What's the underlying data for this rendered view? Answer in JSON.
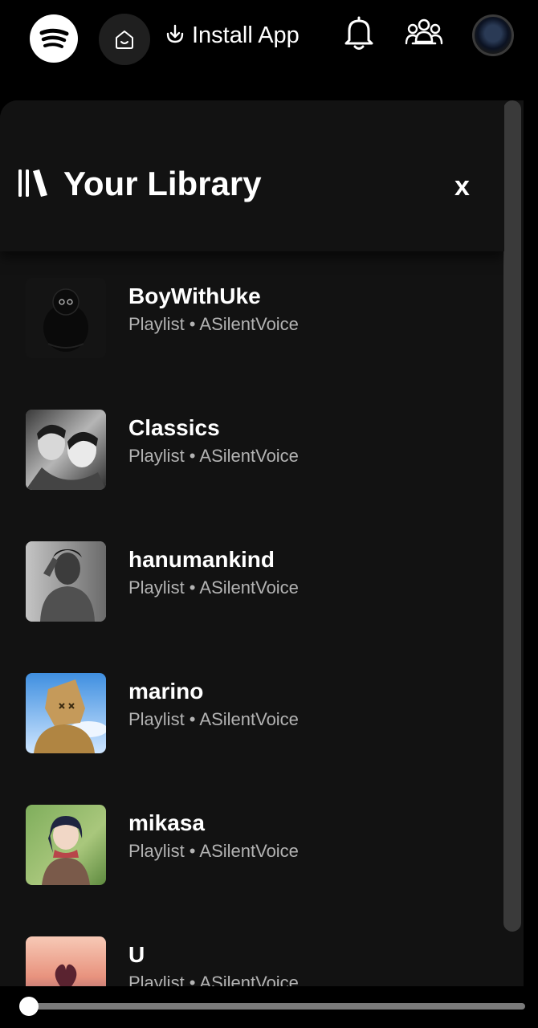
{
  "header": {
    "install_label": "Install App",
    "icons": {
      "logo": "spotify-logo-icon",
      "home": "home-icon",
      "install": "download-icon",
      "bell": "bell-icon",
      "friends": "friends-icon",
      "avatar": "user-avatar"
    }
  },
  "library": {
    "title": "Your Library",
    "close_label": "x",
    "items": [
      {
        "title": "BoyWithUke",
        "subtitle": "Playlist • ASilentVoice"
      },
      {
        "title": "Classics",
        "subtitle": "Playlist • ASilentVoice"
      },
      {
        "title": "hanumankind",
        "subtitle": "Playlist • ASilentVoice"
      },
      {
        "title": "marino",
        "subtitle": "Playlist • ASilentVoice"
      },
      {
        "title": "mikasa",
        "subtitle": "Playlist • ASilentVoice"
      },
      {
        "title": "U",
        "subtitle": "Playlist • ASilentVoice"
      }
    ]
  },
  "colors": {
    "background": "#000000",
    "panel": "#121212",
    "text_primary": "#ffffff",
    "text_secondary": "#b3b3b3"
  },
  "slider": {
    "value": 0
  }
}
